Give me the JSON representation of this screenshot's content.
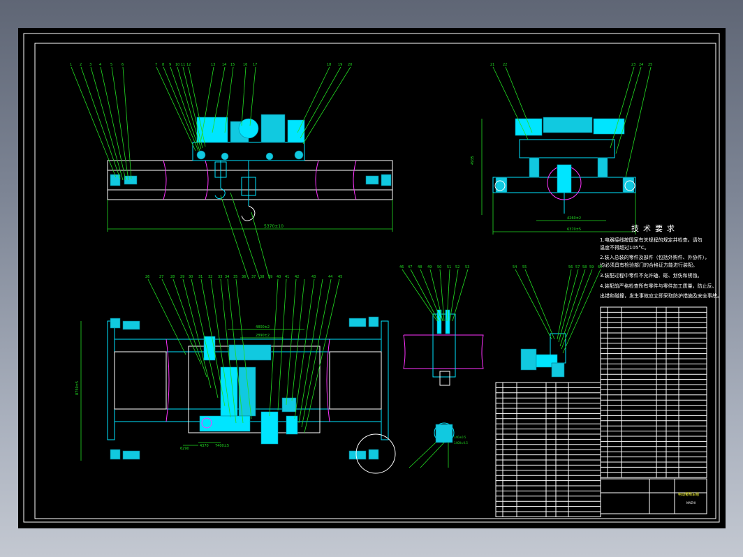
{
  "drawing": {
    "tech_requirements": {
      "title": "技术要求",
      "items": [
        "1.电器接线按国家有关规程的规定并检查。请勿",
        "温度不得超过105°C。",
        "2.装入总装的零件及部件（包括外购件、外协件），",
        "均必须具有检验部门的合格证方能进行装配。",
        "3.装配过程中零件不允许磕、碰、划伤和锈蚀。",
        "4.装配前严格检查所有零件与零件加工质量，防止反、",
        "出错和碰撞，发生事故应立即采取防护措施及安全事故。"
      ]
    },
    "dimensions": {
      "top_main_span": "5370±10",
      "side_height": "4935",
      "side_width": "6370±5",
      "side_inner": "4260±2",
      "plan_height": "8750±5",
      "plan_d1": "4800±2",
      "plan_d2": "2890±2",
      "plan_d3": "6290",
      "plan_d4": "4370",
      "plan_d5": "7400±5",
      "detail_a": "140±0.5",
      "detail_b": "1400±0.5"
    },
    "balloons": {
      "top_left": [
        "1",
        "2",
        "3",
        "4",
        "5",
        "6"
      ],
      "top_mid": [
        "7",
        "8",
        "9",
        "10",
        "11",
        "12",
        "13",
        "14",
        "15",
        "16",
        "17"
      ],
      "top_right": [
        "18",
        "19",
        "20"
      ],
      "side_left": [
        "21",
        "22"
      ],
      "side_right": [
        "23",
        "24",
        "25"
      ],
      "plan": [
        "26",
        "27",
        "28",
        "29",
        "30",
        "31",
        "32",
        "33",
        "34",
        "35",
        "36",
        "37",
        "38",
        "39",
        "40",
        "41",
        "42",
        "43",
        "44",
        "45"
      ],
      "detail1": [
        "46",
        "47",
        "48",
        "49",
        "50",
        "51",
        "52",
        "53"
      ],
      "detail2": [
        "54",
        "55",
        "56",
        "57",
        "58",
        "59",
        "60"
      ]
    },
    "title_block": {
      "drawing_name": "电动葡萄车组",
      "drawing_code": "MAZHI"
    }
  }
}
